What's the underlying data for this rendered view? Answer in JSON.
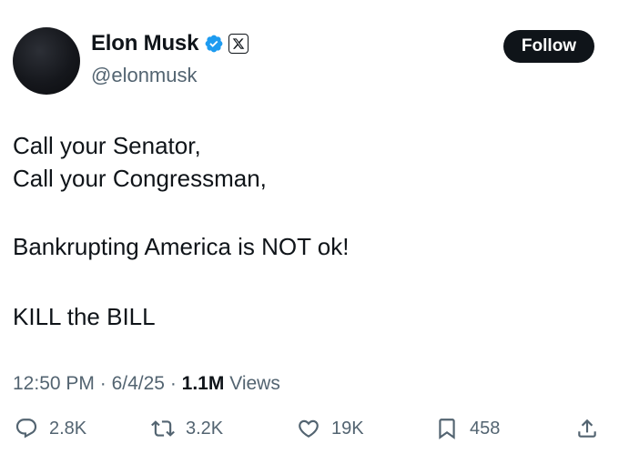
{
  "author": {
    "name": "Elon Musk",
    "handle": "@elonmusk"
  },
  "follow_label": "Follow",
  "tweet": {
    "lines": [
      "Call your Senator,",
      "Call your Congressman,",
      "Bankrupting America is NOT ok!",
      "KILL the BILL"
    ]
  },
  "meta": {
    "time": "12:50 PM",
    "sep1": "·",
    "date": "6/4/25",
    "sep2": "·",
    "views_count": "1.1M",
    "views_label": "Views"
  },
  "actions": {
    "replies": "2.8K",
    "reposts": "3.2K",
    "likes": "19K",
    "bookmarks": "458"
  },
  "icons": {
    "verified": "verified-badge-icon",
    "affiliation": "x-logo-icon",
    "reply": "reply-icon",
    "repost": "repost-icon",
    "like": "heart-icon",
    "bookmark": "bookmark-icon",
    "share": "share-icon"
  },
  "colors": {
    "verified_blue": "#1d9bf0",
    "text_primary": "#0f1419",
    "text_secondary": "#536471",
    "button_bg": "#0f1419"
  }
}
